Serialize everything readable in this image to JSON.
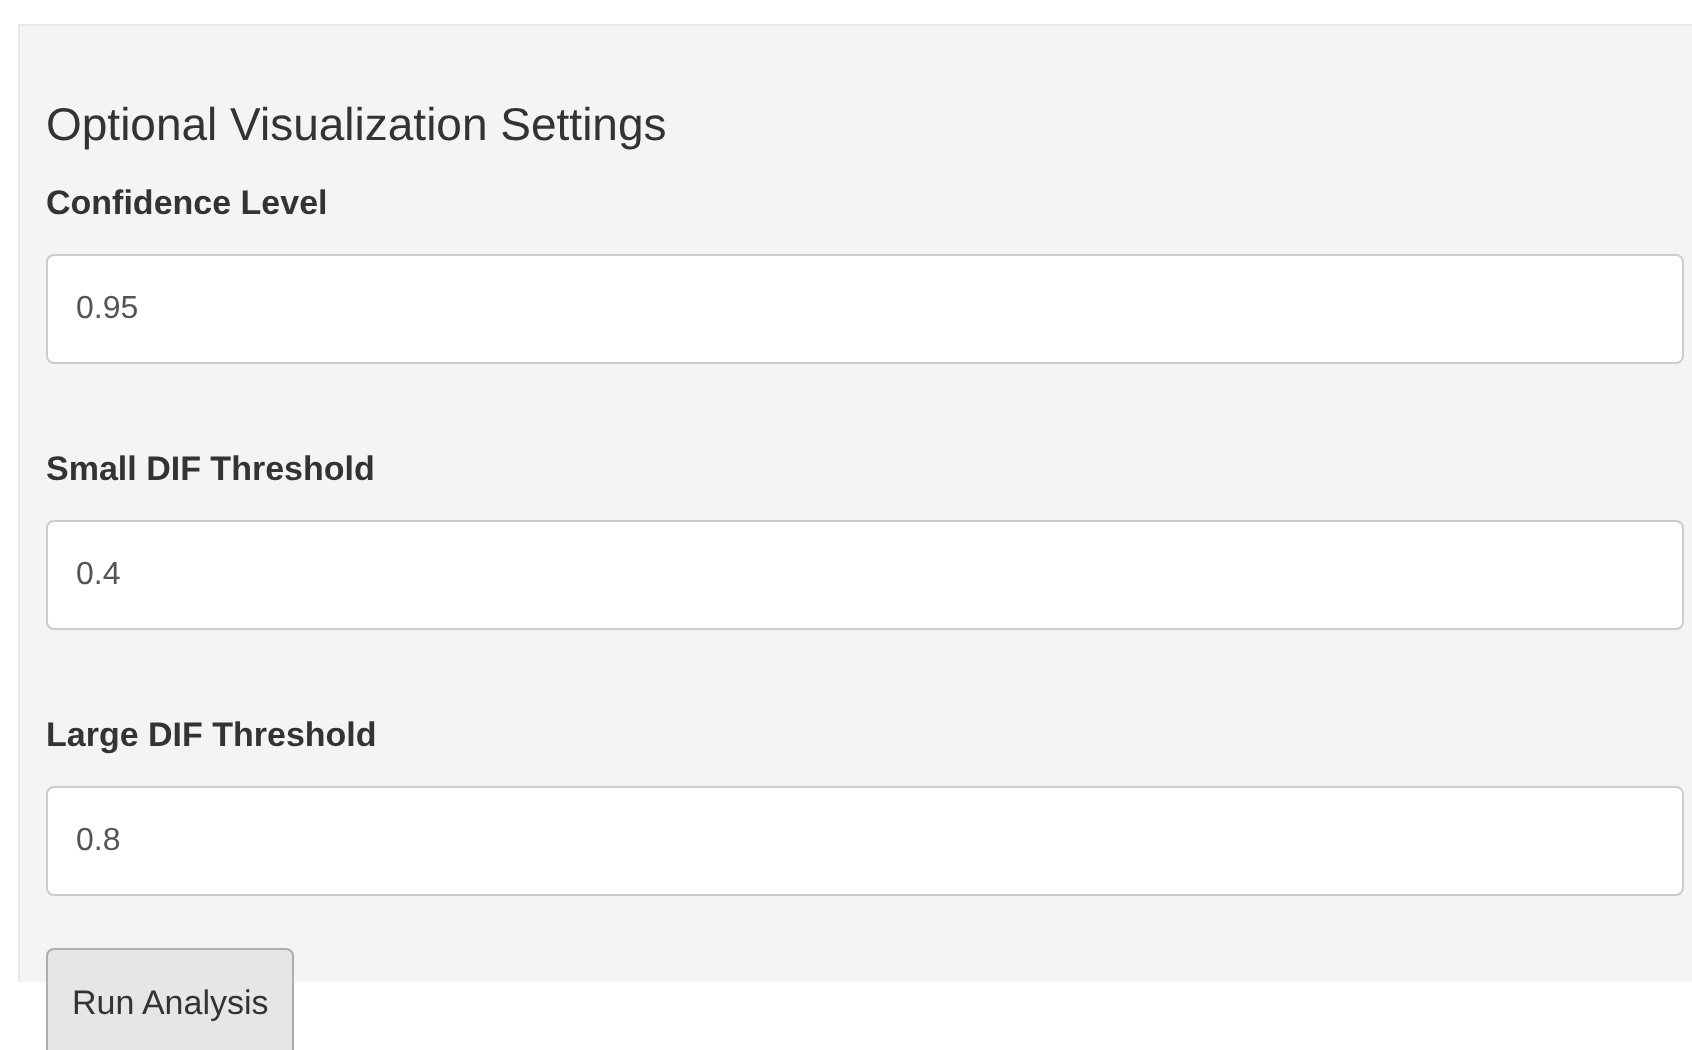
{
  "panel": {
    "title": "Optional Visualization Settings",
    "fields": [
      {
        "label": "Confidence Level",
        "value": "0.95"
      },
      {
        "label": "Small DIF Threshold",
        "value": "0.4"
      },
      {
        "label": "Large DIF Threshold",
        "value": "0.8"
      }
    ],
    "button": "Run Analysis"
  }
}
